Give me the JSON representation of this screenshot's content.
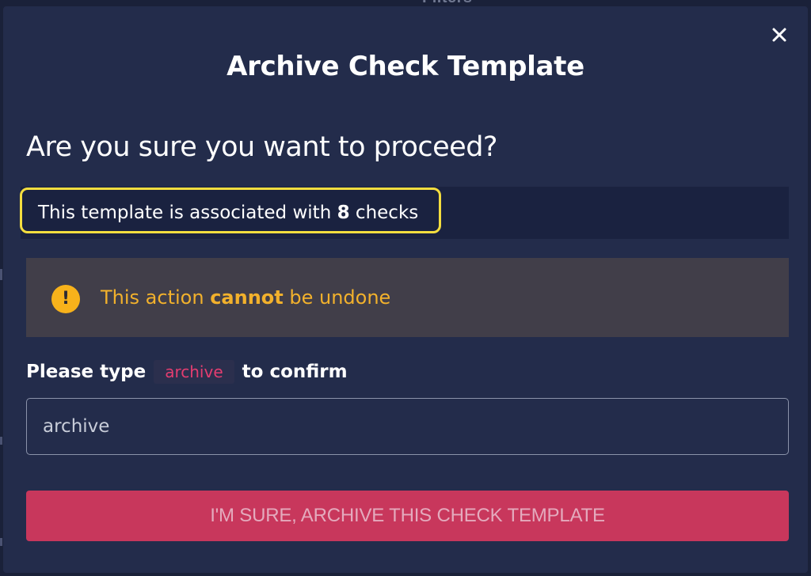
{
  "background": {
    "header_text": "Filters"
  },
  "modal": {
    "title": "Archive Check Template",
    "question": "Are you sure you want to proceed?",
    "info": {
      "prefix": "This template is associated with ",
      "count": "8",
      "suffix": " checks"
    },
    "warning": {
      "icon": "exclamation-icon",
      "prefix": "This action ",
      "emphasis": "cannot",
      "suffix": " be undone"
    },
    "confirm": {
      "prefix": "Please type",
      "keyword": "archive",
      "suffix": "to confirm",
      "input_value": "archive"
    },
    "submit_label": "I'M SURE, ARCHIVE THIS CHECK TEMPLATE",
    "close_icon": "close-icon"
  },
  "colors": {
    "modal_bg": "#232c4b",
    "highlight_border": "#f3dd3f",
    "warning_text": "#f2b12c",
    "warning_bg": "#413e49",
    "keyword": "#e43d70",
    "submit_bg": "#c8375c"
  }
}
